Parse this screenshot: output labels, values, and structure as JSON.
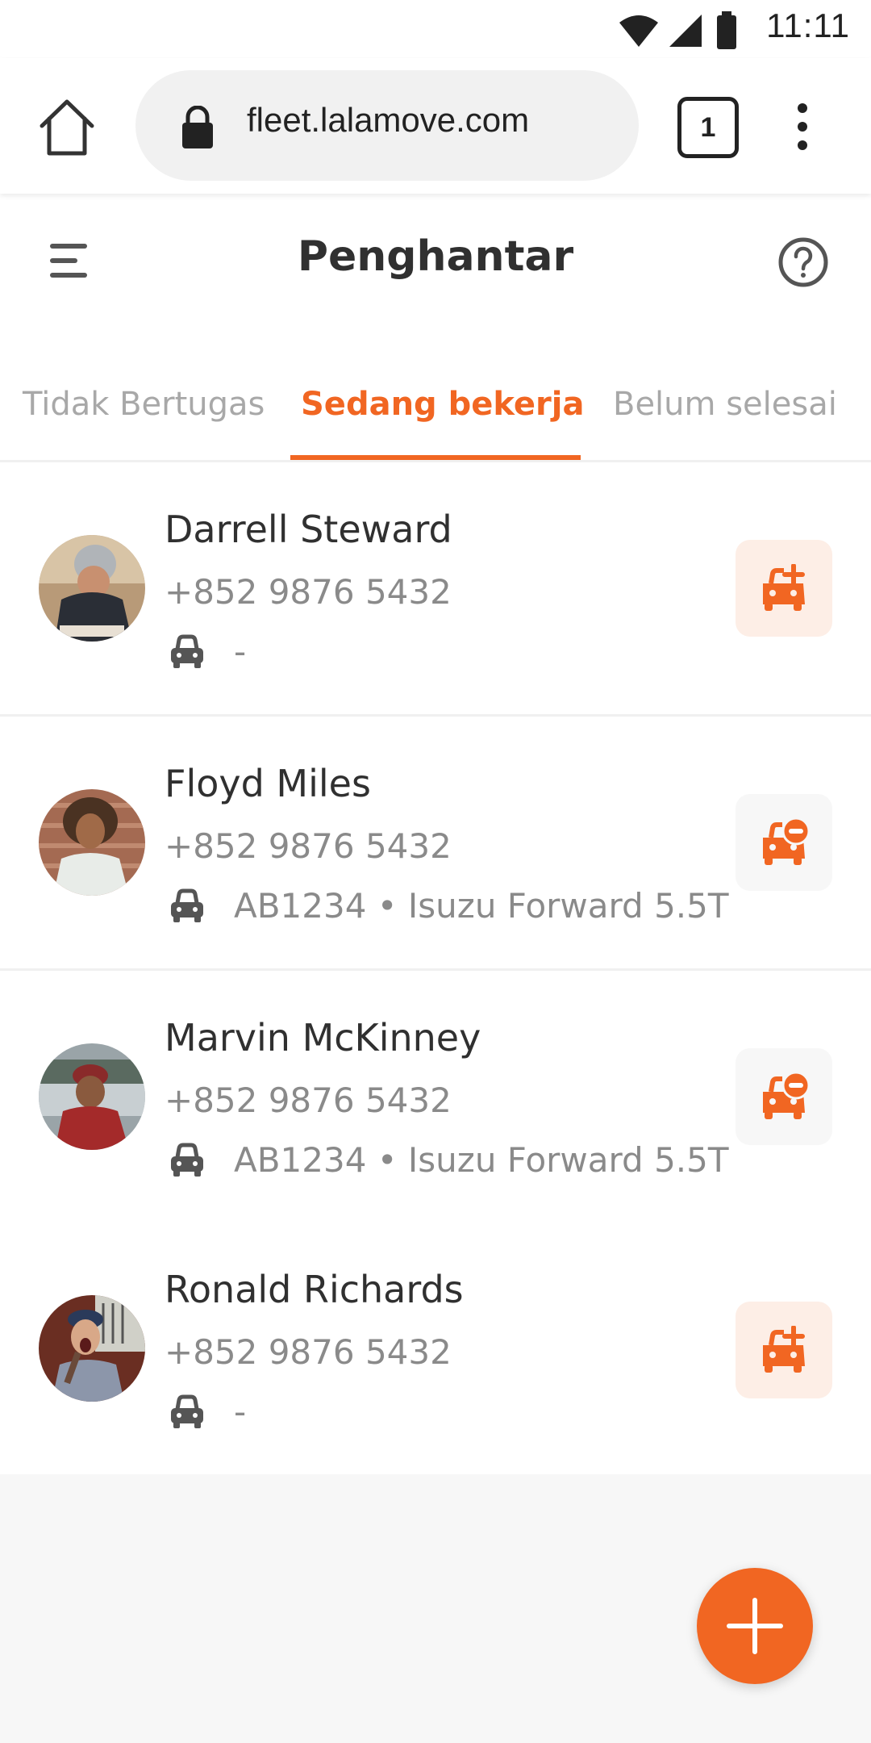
{
  "status_bar": {
    "time": "11:11",
    "icons": [
      "wifi-icon",
      "cellular-signal-icon",
      "battery-icon"
    ]
  },
  "browser": {
    "url": "fleet.lalamove.com",
    "tab_count": "1",
    "icons": [
      "home-icon",
      "lock-icon",
      "more-vertical-icon"
    ]
  },
  "header": {
    "title": "Penghantar",
    "menu_icon": "hamburger-menu-icon",
    "help_icon": "help-circle-icon"
  },
  "tabs": [
    {
      "label": "Tidak Bertugas",
      "active": false
    },
    {
      "label": "Sedang bekerja",
      "active": true
    },
    {
      "label": "Belum selesai",
      "active": false
    }
  ],
  "colors": {
    "accent": "#F16622",
    "accent_light": "#FDEEE6",
    "text_primary": "#303030",
    "text_secondary": "#8A8A8A",
    "background": "#F7F7F7"
  },
  "drivers": [
    {
      "name": "Darrell Steward",
      "phone": "+852 9876 5432",
      "vehicle": "-",
      "action": "assign-vehicle",
      "action_icon": "car-plus-icon"
    },
    {
      "name": "Floyd Miles",
      "phone": "+852 9876 5432",
      "vehicle": "AB1234 • Isuzu Forward 5.5T",
      "action": "unassign-vehicle",
      "action_icon": "car-minus-icon"
    },
    {
      "name": "Marvin McKinney",
      "phone": "+852 9876 5432",
      "vehicle": "AB1234 • Isuzu Forward 5.5T",
      "action": "unassign-vehicle",
      "action_icon": "car-minus-icon"
    },
    {
      "name": "Ronald Richards",
      "phone": "+852 9876 5432",
      "vehicle": "-",
      "action": "assign-vehicle",
      "action_icon": "car-plus-icon"
    }
  ],
  "fab": {
    "icon": "plus-icon",
    "action": "add-driver"
  }
}
